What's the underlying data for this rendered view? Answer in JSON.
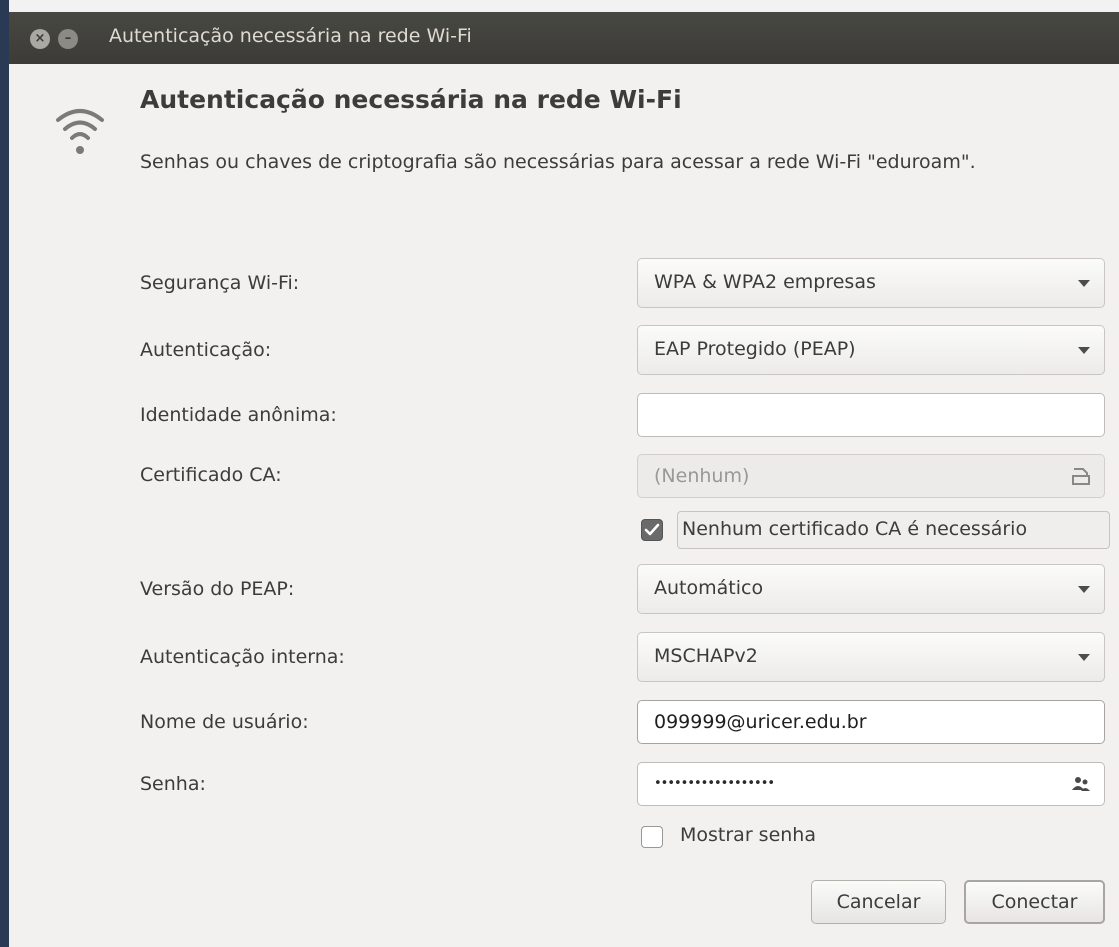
{
  "window": {
    "title": "Autenticação necessária na rede Wi-Fi"
  },
  "dialog": {
    "icon": "wifi-icon",
    "heading": "Autenticação necessária na rede Wi-Fi",
    "description": "Senhas ou chaves de criptografia são necessárias para acessar a rede Wi-Fi \"eduroam\"."
  },
  "form": {
    "security": {
      "label": "Segurança Wi-Fi:",
      "value": "WPA & WPA2 empresas"
    },
    "authentication": {
      "label": "Autenticação:",
      "value": "EAP Protegido (PEAP)"
    },
    "anonymous_identity": {
      "label": "Identidade anônima:",
      "value": ""
    },
    "ca_certificate": {
      "label": "Certificado CA:",
      "value": "(Nenhum)",
      "icon": "file-open-icon"
    },
    "no_ca_required": {
      "label": "Nenhum certificado CA é necessário",
      "checked": true
    },
    "peap_version": {
      "label": "Versão do PEAP:",
      "value": "Automático"
    },
    "inner_auth": {
      "label": "Autenticação interna:",
      "value": "MSCHAPv2"
    },
    "username": {
      "label": "Nome de usuário:",
      "value": "099999@uricer.edu.br"
    },
    "password": {
      "label": "Senha:",
      "value": "••••••••••••••••••",
      "icon": "users-icon"
    },
    "show_password": {
      "label": "Mostrar senha",
      "checked": false
    }
  },
  "buttons": {
    "cancel": "Cancelar",
    "connect": "Conectar"
  }
}
